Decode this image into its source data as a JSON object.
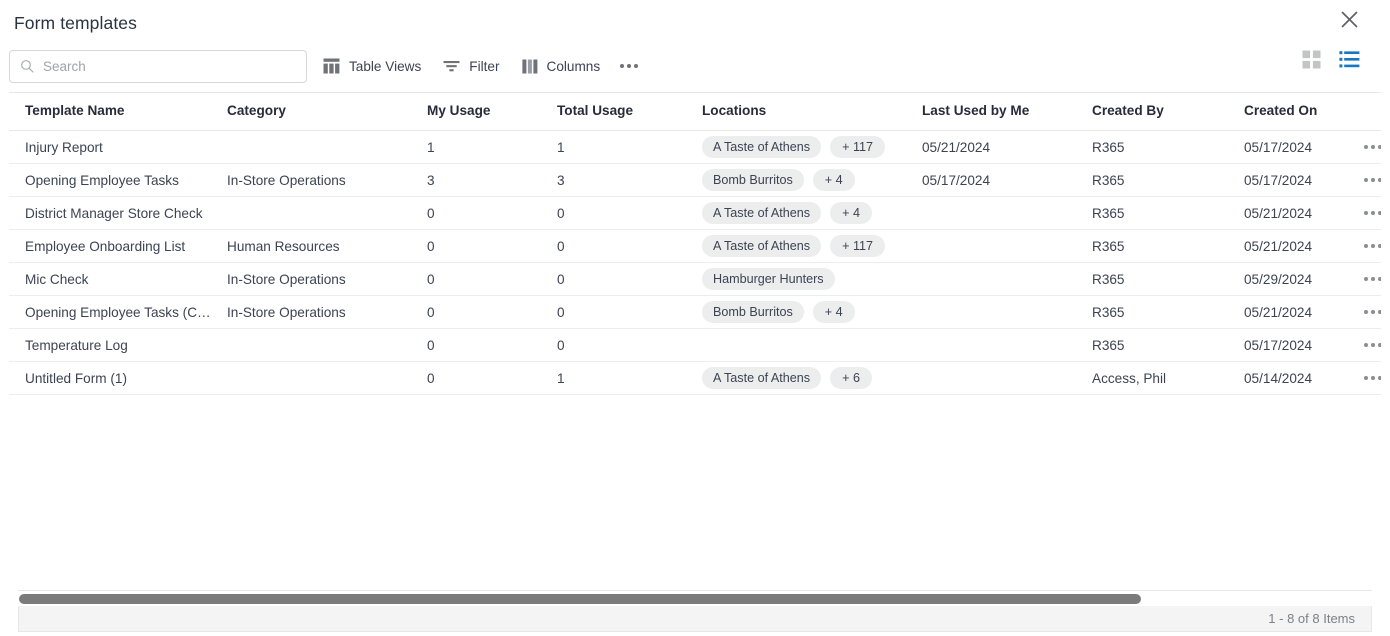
{
  "window": {
    "title": "Form templates",
    "close_label": "×"
  },
  "toolbar": {
    "search": {
      "placeholder": "Search",
      "value": "",
      "icon": "search-icon"
    },
    "buttons": [
      {
        "label": "Table Views",
        "icon": "table-views-icon"
      },
      {
        "label": "Filter",
        "icon": "filter-icon"
      },
      {
        "label": "Columns",
        "icon": "columns-icon"
      }
    ],
    "overflow": {
      "icon": "ellipsis-icon",
      "label": ""
    },
    "views": [
      {
        "name": "grid-view",
        "icon": "grid-view-icon",
        "active": false,
        "color": "#c3c4c6"
      },
      {
        "name": "list-view",
        "icon": "list-view-icon",
        "active": true,
        "color": "#1579c0"
      }
    ]
  },
  "table": {
    "columns": [
      "Template Name",
      "Category",
      "My Usage",
      "Total Usage",
      "Locations",
      "Last Used by Me",
      "Created By",
      "Created On"
    ],
    "rows": [
      {
        "name": "Injury Report",
        "category": "",
        "my_usage": "1",
        "total_usage": "1",
        "locations": [
          "A Taste of Athens"
        ],
        "locations_more": "+ 117",
        "last_used": "05/21/2024",
        "created_by": "R365",
        "created_on": "05/17/2024"
      },
      {
        "name": "Opening Employee Tasks",
        "category": "In-Store Operations",
        "my_usage": "3",
        "total_usage": "3",
        "locations": [
          "Bomb Burritos"
        ],
        "locations_more": "+ 4",
        "last_used": "05/17/2024",
        "created_by": "R365",
        "created_on": "05/17/2024"
      },
      {
        "name": "District Manager Store Check",
        "category": "",
        "my_usage": "0",
        "total_usage": "0",
        "locations": [
          "A Taste of Athens"
        ],
        "locations_more": "+ 4",
        "last_used": "",
        "created_by": "R365",
        "created_on": "05/21/2024"
      },
      {
        "name": "Employee Onboarding List",
        "category": "Human Resources",
        "my_usage": "0",
        "total_usage": "0",
        "locations": [
          "A Taste of Athens"
        ],
        "locations_more": "+ 117",
        "last_used": "",
        "created_by": "R365",
        "created_on": "05/21/2024"
      },
      {
        "name": "Mic Check",
        "category": "In-Store Operations",
        "my_usage": "0",
        "total_usage": "0",
        "locations": [
          "Hamburger Hunters"
        ],
        "locations_more": "",
        "last_used": "",
        "created_by": "R365",
        "created_on": "05/29/2024"
      },
      {
        "name": "Opening Employee Tasks (C…",
        "category": "In-Store Operations",
        "my_usage": "0",
        "total_usage": "0",
        "locations": [
          "Bomb Burritos"
        ],
        "locations_more": "+ 4",
        "last_used": "",
        "created_by": "R365",
        "created_on": "05/21/2024"
      },
      {
        "name": "Temperature Log",
        "category": "",
        "my_usage": "0",
        "total_usage": "0",
        "locations": [],
        "locations_more": "",
        "last_used": "",
        "created_by": "R365",
        "created_on": "05/17/2024"
      },
      {
        "name": "Untitled Form (1)",
        "category": "",
        "my_usage": "0",
        "total_usage": "1",
        "locations": [
          "A Taste of Athens"
        ],
        "locations_more": "+ 6",
        "last_used": "",
        "created_by": "Access, Phil",
        "created_on": "05/14/2024"
      }
    ]
  },
  "footer": {
    "count_text": "1 - 8 of 8 Items"
  },
  "colors": {
    "accent": "#1579c0",
    "chip_bg": "#eceded",
    "text": "#3c4352",
    "muted": "#7d8089",
    "border": "#e6e7e9",
    "scroll_thumb": "#7b7b7b"
  }
}
